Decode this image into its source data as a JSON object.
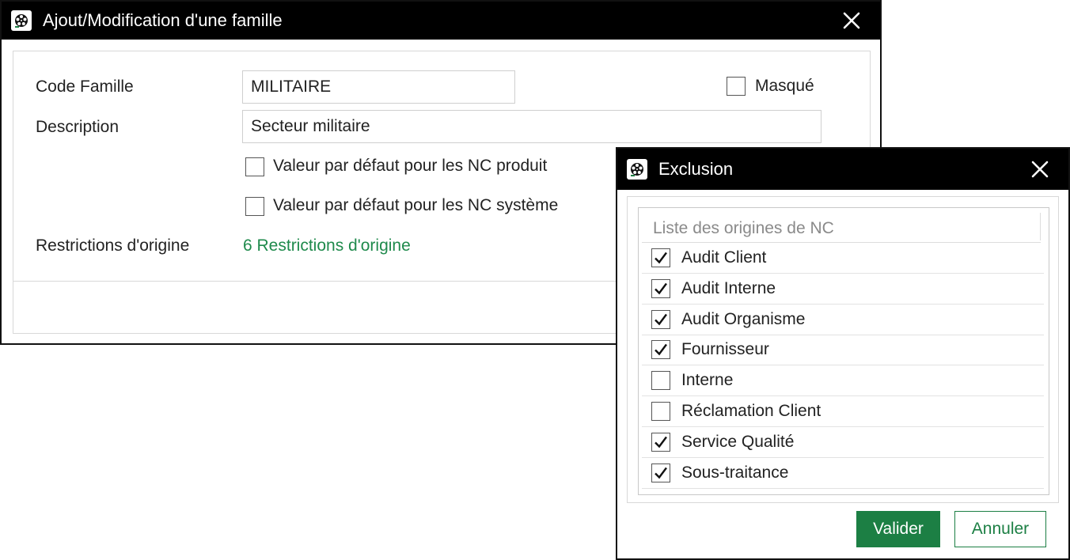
{
  "main_dialog": {
    "title": "Ajout/Modification d'une famille",
    "code_label": "Code Famille",
    "code_value": "MILITAIRE",
    "masque_label": "Masqué",
    "masque_checked": false,
    "description_label": "Description",
    "description_value": "Secteur militaire",
    "default_produit_label": "Valeur par défaut pour les NC produit",
    "default_produit_checked": false,
    "default_systeme_label": "Valeur par défaut pour les NC système",
    "default_systeme_checked": false,
    "restrictions_label": "Restrictions d'origine",
    "restrictions_link": "6 Restrictions d'origine"
  },
  "exclusion_dialog": {
    "title": "Exclusion",
    "list_header": "Liste des origines de NC",
    "items": [
      {
        "label": "Audit Client",
        "checked": true
      },
      {
        "label": "Audit Interne",
        "checked": true
      },
      {
        "label": "Audit Organisme",
        "checked": true
      },
      {
        "label": "Fournisseur",
        "checked": true
      },
      {
        "label": "Interne",
        "checked": false
      },
      {
        "label": "Réclamation Client",
        "checked": false
      },
      {
        "label": "Service Qualité",
        "checked": true
      },
      {
        "label": "Sous-traitance",
        "checked": true
      }
    ],
    "validate_label": "Valider",
    "cancel_label": "Annuler"
  },
  "colors": {
    "accent_green": "#1c7f44",
    "link_green": "#1f8a4c",
    "titlebar": "#000000"
  },
  "icons": {
    "app": "film-reel-icon",
    "close": "close-icon",
    "check": "checkmark-icon"
  }
}
